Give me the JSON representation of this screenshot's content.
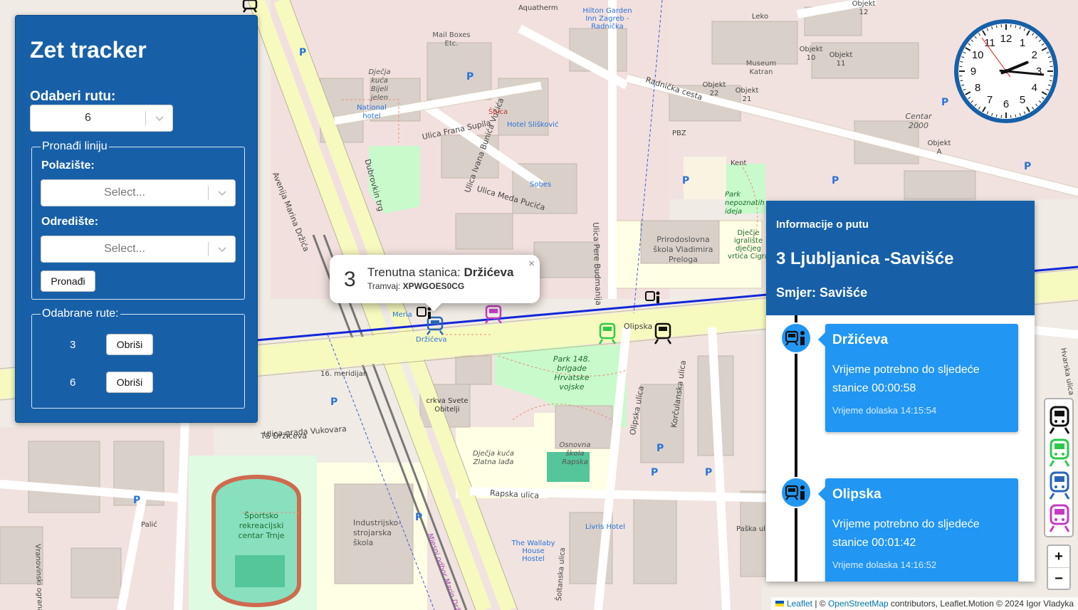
{
  "app": {
    "title": "Zet tracker"
  },
  "panel": {
    "route_label": "Odaberi rutu:",
    "route_value": "6",
    "find_legend": "Pronađi liniju",
    "from_label": "Polazište:",
    "from_placeholder": "Select...",
    "to_label": "Odredište:",
    "to_placeholder": "Select...",
    "find_button": "Pronađi",
    "selected_legend": "Odabrane rute:",
    "selected_routes": [
      {
        "number": "3",
        "delete_label": "Obriši"
      },
      {
        "number": "6",
        "delete_label": "Obriši"
      }
    ]
  },
  "popup": {
    "line_number": "3",
    "current_stop_label": "Trenutna stanica:",
    "current_stop": "Držićeva",
    "tram_label": "Tramvaj:",
    "tram_id": "XPWGOES0CG",
    "close_symbol": "×"
  },
  "info": {
    "header": "Informacije o putu",
    "route": "3 Ljubljanica -Savišće",
    "direction": "Smjer: Savišće",
    "stops": [
      {
        "name": "Držićeva",
        "duration": "Vrijeme potrebno do sljedeće stanice 00:00:58",
        "arrival": "Vrijeme dolaska 14:15:54"
      },
      {
        "name": "Olipska",
        "duration": "Vrijeme potrebno do sljedeće stanice 00:01:42",
        "arrival": "Vrijeme dolaska 14:16:52"
      }
    ]
  },
  "clock": {
    "time": "14:15:54",
    "numerals": [
      "12",
      "1",
      "2",
      "3",
      "4",
      "5",
      "6",
      "7",
      "8",
      "9",
      "10",
      "11"
    ]
  },
  "zoom": {
    "in": "+",
    "out": "−"
  },
  "attribution": {
    "leaflet": "Leaflet",
    "sep": " | © ",
    "osm": "OpenStreetMap",
    "rest": " contributors, Leaflet.Motion © 2024 Igor Vladyka"
  },
  "map": {
    "labels": [
      {
        "text": "Avenija Marina Držića"
      },
      {
        "text": "Ulica grada Vukovara"
      },
      {
        "text": "Radnička cesta"
      },
      {
        "text": "Ulica Frana Supila"
      },
      {
        "text": "Ulica Meda Pucića"
      },
      {
        "text": "Dubrovkin trg"
      },
      {
        "text": "Ulica Pere Budmanija"
      },
      {
        "text": "Olipska"
      },
      {
        "text": "Olipska ulica"
      },
      {
        "text": "Korčulanska ulica"
      },
      {
        "text": "Rapska ulica"
      },
      {
        "text": "Park 148. brigade Hrvatske vojske"
      },
      {
        "text": "Prirodoslovna škola Vladimira Preloga"
      },
      {
        "text": "Športsko rekreacijski centar Trnje"
      },
      {
        "text": "Industrijsko-strojarska škola"
      },
      {
        "text": "Osnovna škola Rapska"
      },
      {
        "text": "crkva Svete Obitelji"
      },
      {
        "text": "Dječja kuća Zlatna lađa"
      },
      {
        "text": "Museum Katran"
      },
      {
        "text": "Hilton Garden Inn Zagreb - Radnička"
      },
      {
        "text": "Aquatherm"
      },
      {
        "text": "Mail Boxes Etc."
      },
      {
        "text": "Hotel Slišković"
      },
      {
        "text": "National hotel"
      },
      {
        "text": "Livris Hotel"
      },
      {
        "text": "The Wallaby House Hostel"
      },
      {
        "text": "Centar 2000"
      },
      {
        "text": "Držićeva"
      },
      {
        "text": "Park nepoznatih ideja"
      },
      {
        "text": "Dječje igralište dječjeg vrtića Cigra"
      },
      {
        "text": "16. meridijan"
      },
      {
        "text": "TS Držićeva"
      },
      {
        "text": "Palić"
      },
      {
        "text": "Vranovinski ogranak"
      },
      {
        "text": "Mjesni odbor Marin Držić"
      },
      {
        "text": "Šoltanska ulica"
      },
      {
        "text": "Paška ulica"
      },
      {
        "text": "Hvarska ulica"
      },
      {
        "text": "Ulica Ivana Bunića Vučića"
      },
      {
        "text": "Dječja kuća Bijeli jelen"
      },
      {
        "text": "Kent"
      },
      {
        "text": "PBZ"
      },
      {
        "text": "Sobes"
      },
      {
        "text": "Špica"
      },
      {
        "text": "Leko"
      },
      {
        "text": "Meria"
      },
      {
        "text": "Objekt 10"
      },
      {
        "text": "Objekt 11"
      },
      {
        "text": "Objekt 22"
      },
      {
        "text": "Objekt 21"
      },
      {
        "text": "Objekt 12"
      },
      {
        "text": "Objekt A"
      }
    ]
  },
  "colors": {
    "panel_blue": "#1760a8",
    "card_blue": "#2196f3",
    "route_line": "#1226d6",
    "tram_black": "#111111",
    "tram_green": "#2ec94a",
    "tram_blue": "#2a66b8",
    "tram_magenta": "#c43cc4"
  },
  "icons": {
    "tram": "tram-icon",
    "tram_stop": "tram-stop-icon",
    "chevron": "chevron-down-icon"
  }
}
